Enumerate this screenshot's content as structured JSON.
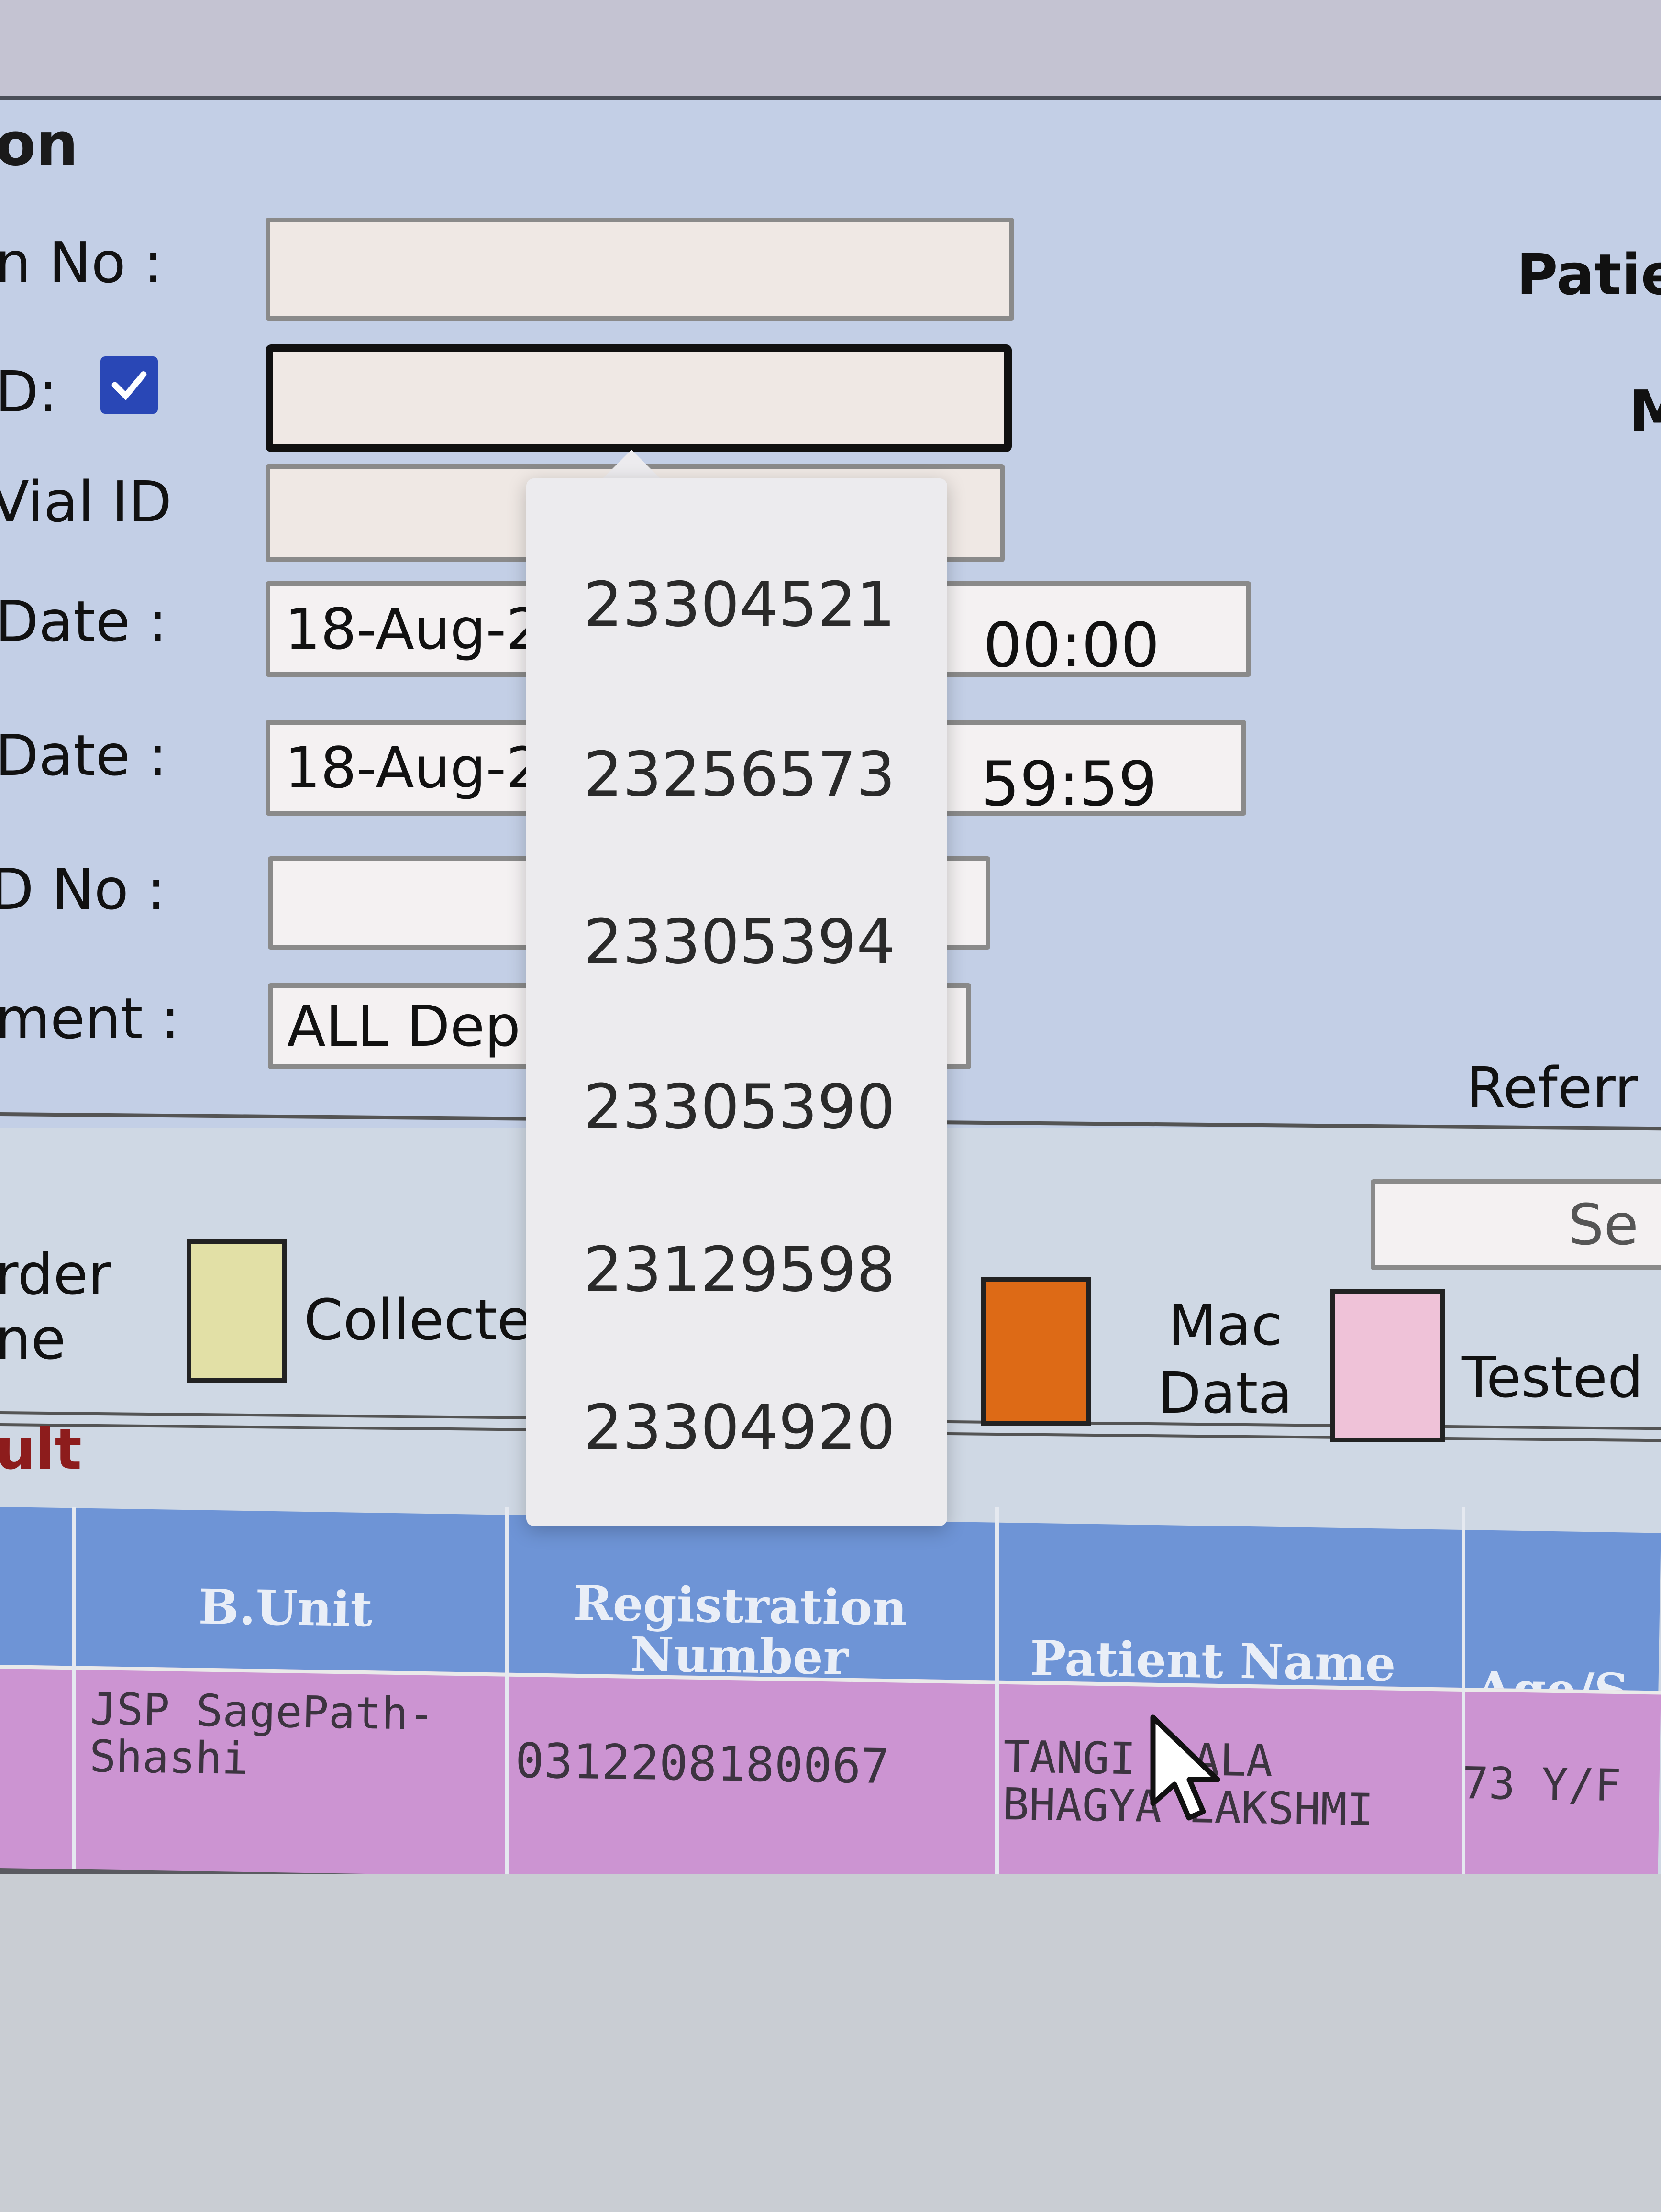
{
  "form": {
    "title_fragment": "on",
    "labels": {
      "reg_no": "n No :",
      "id": "D:",
      "vial_id": "Vial ID",
      "from_date": "Date :",
      "to_date": "Date :",
      "op_no": "D No :",
      "department": "ment :"
    },
    "id_checkbox_checked": true,
    "from_date_value": "18-Aug-2",
    "from_time_value": "00:00",
    "to_date_value": "18-Aug-2",
    "to_time_value": "59:59",
    "department_value": "ALL Dep",
    "right_labels": {
      "patient": "Patie",
      "m": "M",
      "referral": "Referr",
      "search_button": "Se"
    }
  },
  "dropdown": {
    "options": [
      "23304521",
      "23256573",
      "23305394",
      "23305390",
      "23129598",
      "23304920"
    ]
  },
  "legend": {
    "order_label_1": "rder",
    "order_label_2": "ne",
    "collected_label": "Collecte",
    "mac_data_label_1": "Mac",
    "mac_data_label_2": "Data",
    "tested_label": "Tested",
    "colors": {
      "collected": "#e2e0a6",
      "mac_data": "#dd6a16",
      "tested": "#efc2d8"
    }
  },
  "result": {
    "section_title": "ult",
    "columns": [
      "B.Unit",
      "Registration Number",
      "Patient Name",
      "Age/S"
    ],
    "rows": [
      {
        "b_unit": "JSP SagePath-Shashi",
        "registration_number": "0312208180067",
        "patient_name": "TANGIRALA BHAGYA LAKSHMI",
        "patient_name_visible_1": "TANGI",
        "patient_name_visible_1b": "ALA",
        "patient_name_visible_2": "BHAGYA LAKSHMI",
        "b_unit_line1": "JSP SagePath-",
        "b_unit_line2": "Shashi",
        "age_sex": "73 Y/F"
      }
    ],
    "row_color": "#cc94d2",
    "header_color": "#6e94d6"
  }
}
